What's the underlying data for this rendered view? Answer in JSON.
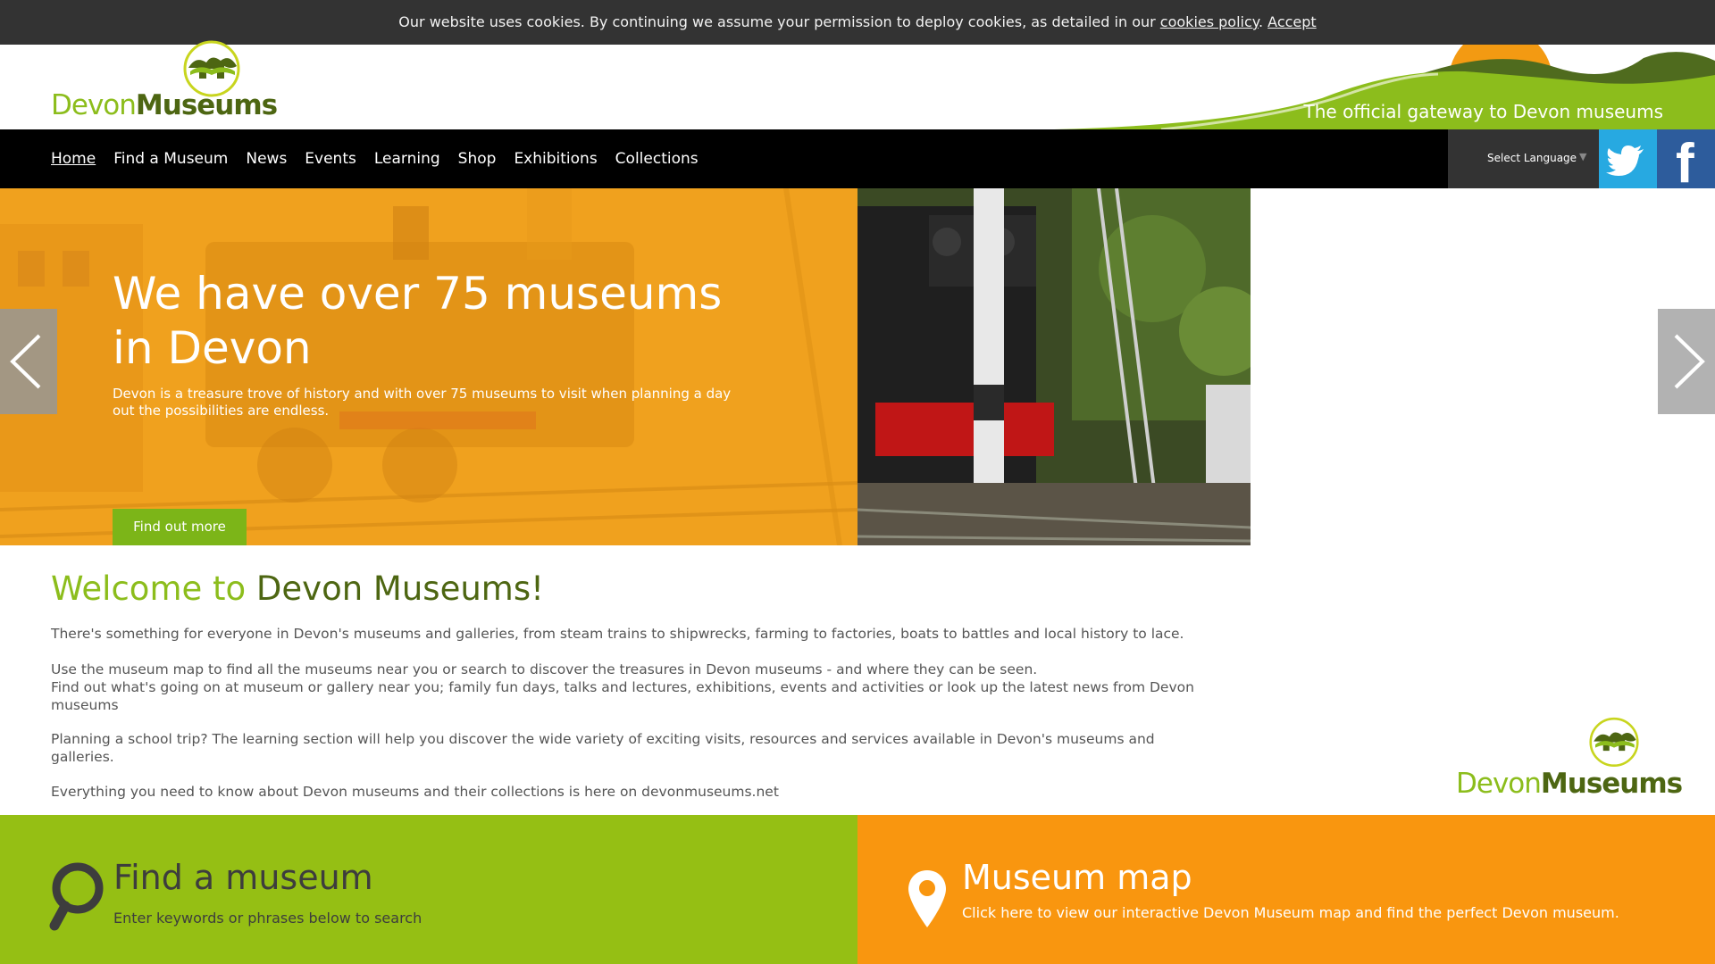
{
  "cookie_bar": {
    "text": "Our website uses cookies. By continuing we assume your permission to deploy cookies, as detailed in our",
    "policy_link": "cookies policy",
    "separator": ".",
    "accept": "Accept"
  },
  "header": {
    "logo_devon": "Devon",
    "logo_museums": "Museums",
    "tagline": "The official gateway to Devon museums"
  },
  "nav": {
    "items": [
      "Home",
      "Find a Museum",
      "News",
      "Events",
      "Learning",
      "Shop",
      "Exhibitions",
      "Collections"
    ],
    "language_label": "Select Language",
    "language_arrow": "▼"
  },
  "hero": {
    "title": "We have over 75 museums in Devon",
    "text": "Devon is a treasure trove of history and with over 75 museums to visit when planning a day out the possibilities are endless.",
    "button": "Find out more"
  },
  "welcome": {
    "title_part1": "Welcome to",
    "title_part2": "Devon Museums!",
    "paragraphs": [
      "There's something for everyone in Devon's museums and galleries, from steam trains to shipwrecks, farming to factories, boats to battles and local history to lace.",
      "Use the museum map to find all the museums near you or search to discover the treasures in Devon museums - and where they can be seen.",
      "Find out what's going on at museum or gallery near you; family fun days, talks and lectures, exhibitions, events and activities or look up the latest news from Devon museums",
      "Planning a school trip? The learning section will help you discover the wide variety of exciting visits, resources and services available in Devon's museums and galleries.",
      "Everything you need to know about Devon museums and their collections is here on devonmuseums.net"
    ]
  },
  "panels": {
    "find_title": "Find a museum",
    "find_sub": "Enter keywords or phrases below to search",
    "map_title": "Museum map",
    "map_sub": "Click here to view our interactive Devon Museum map and find the perfect Devon museum."
  },
  "colors": {
    "brand_green": "#8cbd1c",
    "dark_green": "#4d6612",
    "orange": "#f0a11e",
    "panel_green": "#95bf14",
    "panel_orange": "#f9960f",
    "twitter": "#27a9e1",
    "facebook": "#2d5c9c"
  },
  "icons": [
    "twitter-icon",
    "facebook-icon",
    "search-icon",
    "map-pin-icon",
    "chevron-left-icon",
    "chevron-right-icon"
  ]
}
